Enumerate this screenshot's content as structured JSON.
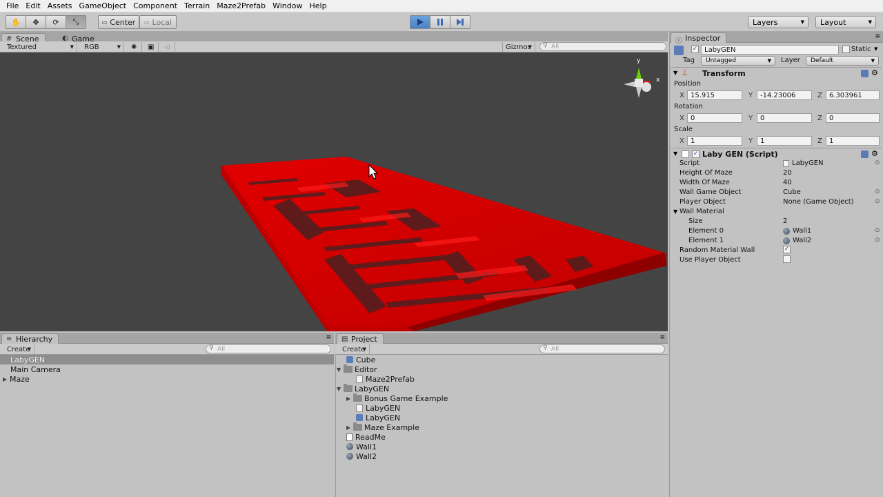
{
  "menu": [
    "File",
    "Edit",
    "Assets",
    "GameObject",
    "Component",
    "Terrain",
    "Maze2Prefab",
    "Window",
    "Help"
  ],
  "toolbar": {
    "pivot": "Center",
    "space": "Local",
    "layers": "Layers",
    "layout": "Layout"
  },
  "scene": {
    "tab_scene": "Scene",
    "tab_game": "Game",
    "render_mode": "Textured",
    "color_mode": "RGB",
    "gizmos": "Gizmos",
    "search_placeholder": "All",
    "gizmo_axes": [
      "y",
      "x"
    ]
  },
  "hierarchy": {
    "title": "Hierarchy",
    "create": "Create",
    "search_placeholder": "All",
    "items": [
      "LabyGEN",
      "Main Camera",
      "Maze"
    ]
  },
  "project": {
    "title": "Project",
    "create": "Create",
    "search_placeholder": "All",
    "items": [
      "Cube",
      "Editor",
      "Maze2Prefab",
      "LabyGEN",
      "Bonus Game Example",
      "LabyGEN",
      "LabyGEN",
      "Maze Example",
      "ReadMe",
      "Wall1",
      "Wall2"
    ]
  },
  "inspector": {
    "title": "Inspector",
    "object_name": "LabyGEN",
    "static_label": "Static",
    "tag_label": "Tag",
    "tag_value": "Untagged",
    "layer_label": "Layer",
    "layer_value": "Default",
    "transform": {
      "title": "Transform",
      "position_label": "Position",
      "rotation_label": "Rotation",
      "scale_label": "Scale",
      "position": {
        "x": "15.915",
        "y": "-14.23006",
        "z": "6.303961"
      },
      "rotation": {
        "x": "0",
        "y": "0",
        "z": "0"
      },
      "scale": {
        "x": "1",
        "y": "1",
        "z": "1"
      },
      "x": "X",
      "y": "Y",
      "z": "Z"
    },
    "script": {
      "title": "Laby GEN (Script)",
      "rows": [
        {
          "label": "Script",
          "value": "LabyGEN"
        },
        {
          "label": "Height Of Maze",
          "value": "20"
        },
        {
          "label": "Width Of Maze",
          "value": "40"
        },
        {
          "label": "Wall Game Object",
          "value": "Cube"
        },
        {
          "label": "Player Object",
          "value": "None (Game Object)"
        }
      ],
      "wall_material_label": "Wall Material",
      "size_label": "Size",
      "size_value": "2",
      "elements": [
        {
          "label": "Element 0",
          "value": "Wall1"
        },
        {
          "label": "Element 1",
          "value": "Wall2"
        }
      ],
      "random_material_label": "Random Material Wall",
      "random_material_checked": true,
      "use_player_label": "Use Player Object",
      "use_player_checked": false
    }
  },
  "colors": {
    "maze_red": "#d40000",
    "selection_blue": "#3d6ab8",
    "viewport_bg": "#444444"
  }
}
